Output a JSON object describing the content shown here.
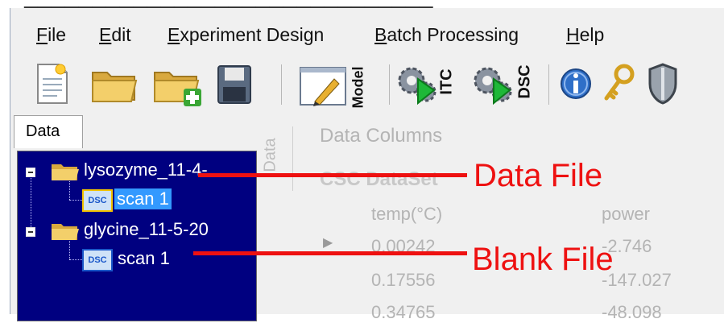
{
  "window_title": "",
  "menu": [
    {
      "key": "file",
      "mnemonic": "F",
      "rest": "ile"
    },
    {
      "key": "edit",
      "mnemonic": "E",
      "rest": "dit"
    },
    {
      "key": "experiment-design",
      "mnemonic": "E",
      "rest": "xperiment Design"
    },
    {
      "key": "batch-processing",
      "mnemonic": "B",
      "rest": "atch Processing"
    },
    {
      "key": "help",
      "mnemonic": "H",
      "rest": "elp"
    }
  ],
  "toolbar": {
    "model_label": "Model",
    "itc_label": "ITC",
    "dsc_label": "DSC"
  },
  "left_panel": {
    "tab_label": "Data",
    "tree": [
      {
        "label": "lysozyme_11-4-",
        "child": "scan 1",
        "child_icon": "DSC"
      },
      {
        "label": "glycine_11-5-20",
        "child": "scan 1",
        "child_icon": "DSC"
      }
    ]
  },
  "right_panel": {
    "vertical_tab": "Data",
    "heading": "Data Columns",
    "dataset_label": "CSC DataSet",
    "columns": [
      "temp(°C)",
      "power"
    ],
    "rows": [
      [
        "0.00242",
        "-2.746"
      ],
      [
        "0.17556",
        "-147.027"
      ],
      [
        "0.34765",
        "-48.098"
      ]
    ]
  },
  "annotations": {
    "data_file": "Data File",
    "blank_file": "Blank File"
  },
  "colors": {
    "tree_bg": "#000080",
    "selection": "#3399ff",
    "annotation": "#ee1111"
  }
}
